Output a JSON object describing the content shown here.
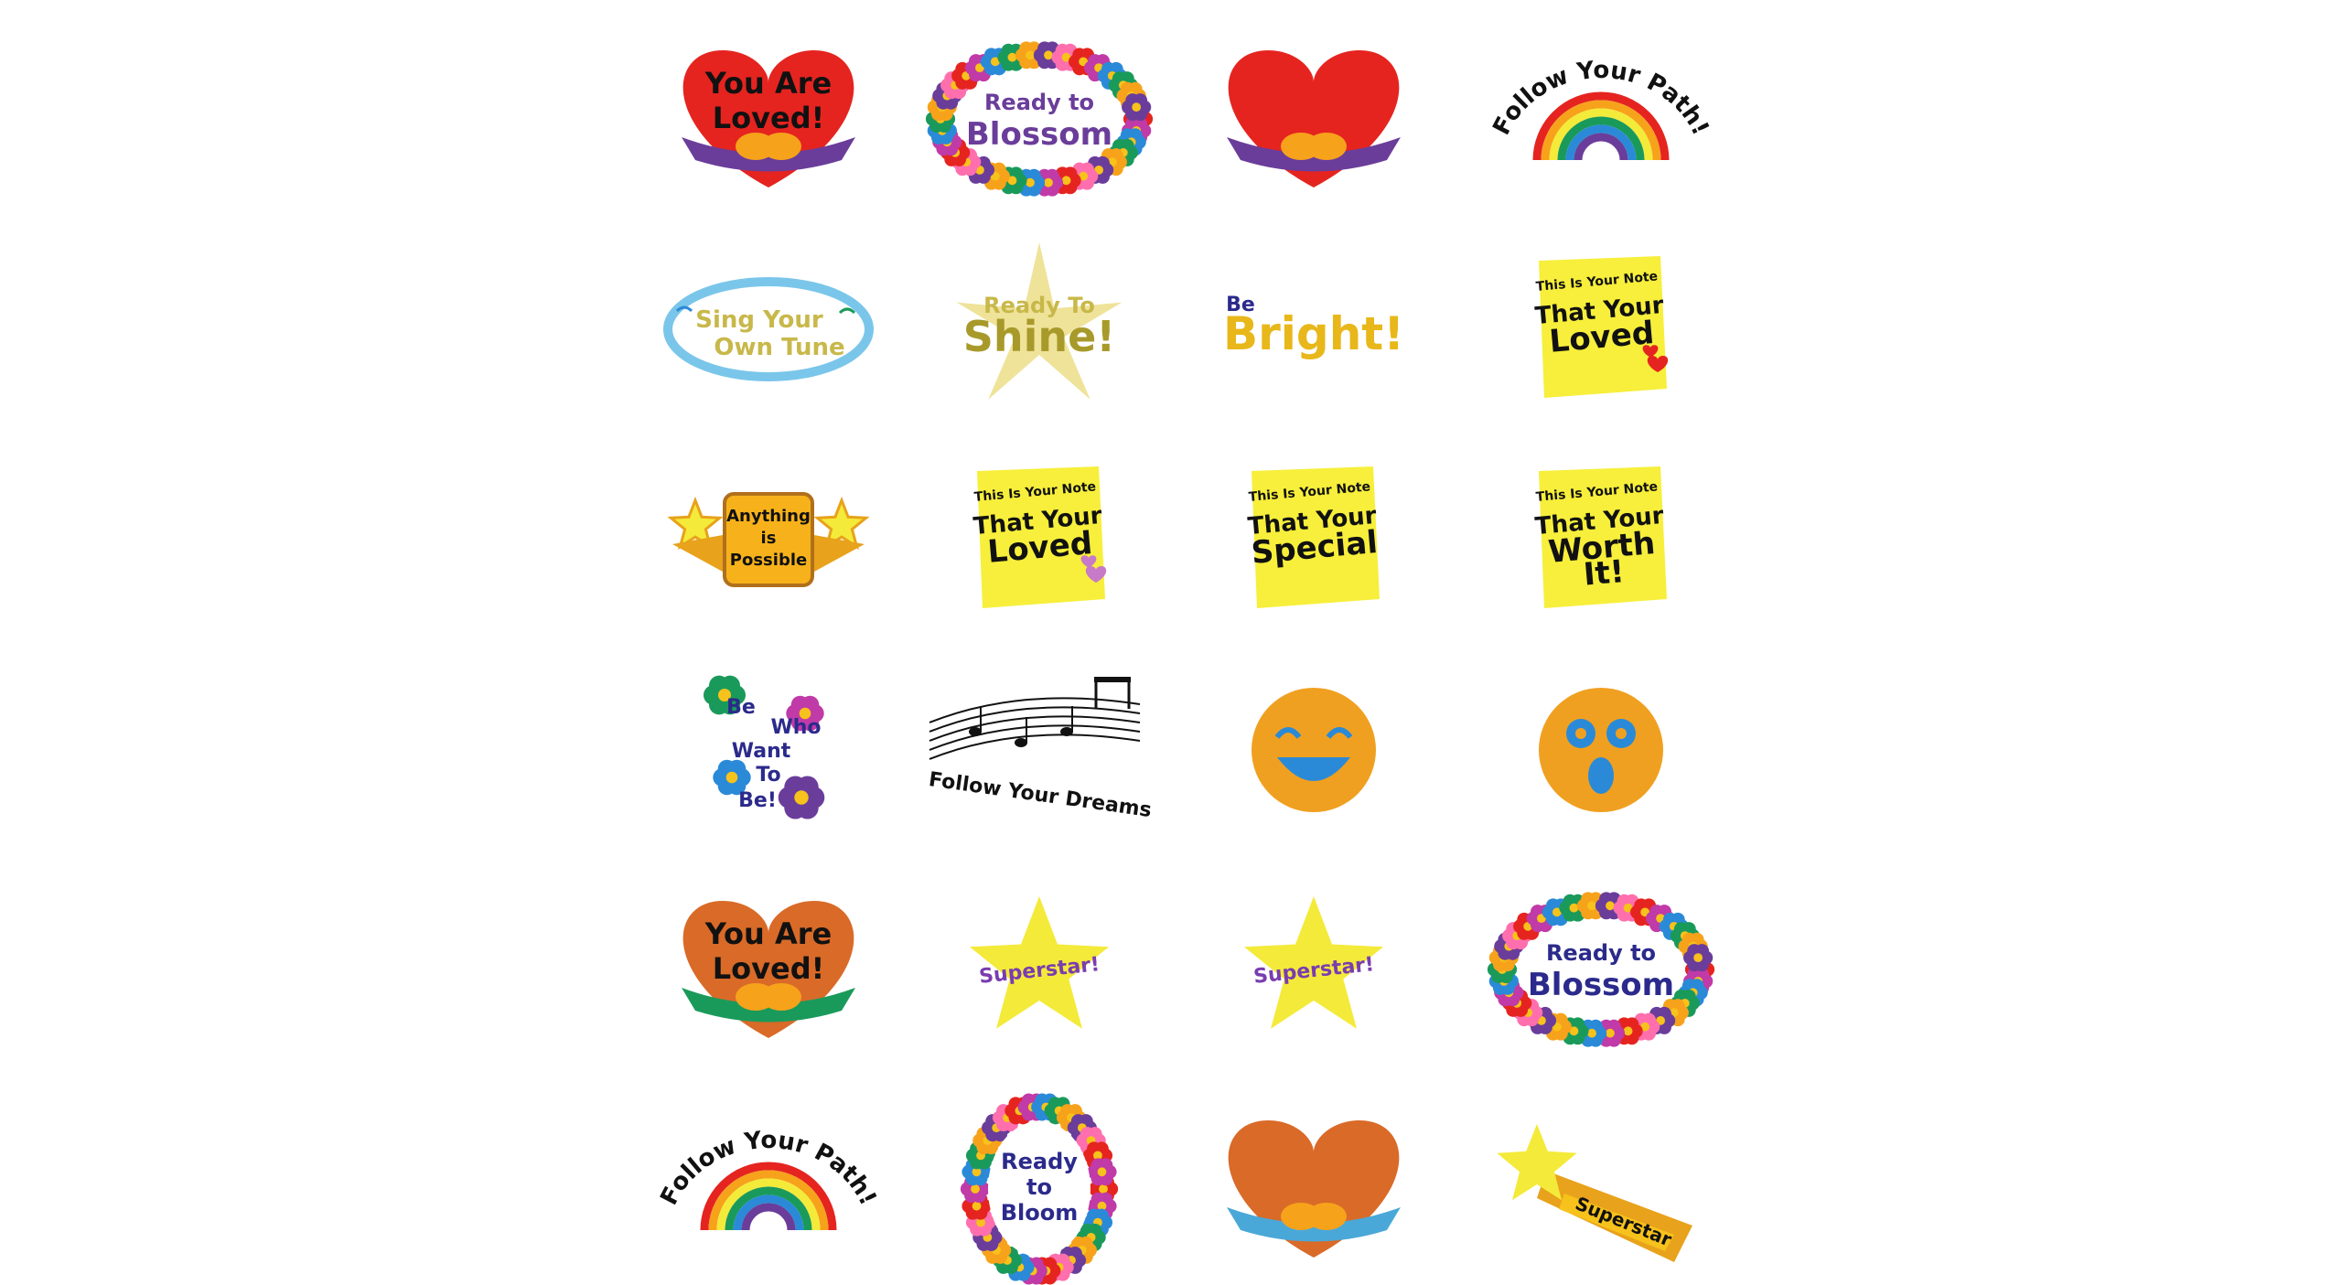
{
  "palette": {
    "red": "#e52420",
    "purple": "#6a3d9a",
    "orange_heart": "#d96a28",
    "orange_hands": "#f7a21b",
    "green_band": "#1a9a5a",
    "teal_band": "#4aa8d8",
    "yellow": "#f4ea3a",
    "note_yellow": "#f7ef3b",
    "gold": "#c8b84a",
    "navy": "#2b2a8c",
    "black": "#111111",
    "emoji_orange": "#f0a020",
    "emoji_blue": "#2a8ad8"
  },
  "stickers": [
    {
      "id": "s1",
      "kind": "heart",
      "heart": "#e52420",
      "band": "#6a3d9a",
      "lines": [
        "You Are",
        "Loved!"
      ]
    },
    {
      "id": "s2",
      "kind": "flower-oval",
      "lines": [
        "Ready to",
        "Blossom"
      ],
      "text_color": "#6a3d9a"
    },
    {
      "id": "s3",
      "kind": "heart",
      "heart": "#e52420",
      "band": "#6a3d9a",
      "lines": []
    },
    {
      "id": "s4",
      "kind": "rainbow-arc",
      "text": "Follow Your Path!"
    },
    {
      "id": "s5",
      "kind": "oval-birds",
      "lines": [
        "Sing Your",
        "Own Tune"
      ]
    },
    {
      "id": "s6",
      "kind": "sunburst",
      "lines": [
        "Ready To",
        "Shine!"
      ]
    },
    {
      "id": "s7",
      "kind": "be-bright",
      "small": "Be",
      "big": "Bright!"
    },
    {
      "id": "s8",
      "kind": "note",
      "lines": [
        "This Is Your Note",
        "That Your",
        "Loved"
      ],
      "hearts": "#e52420"
    },
    {
      "id": "s9",
      "kind": "star-badge",
      "lines": [
        "Anything",
        "is",
        "Possible"
      ]
    },
    {
      "id": "s10",
      "kind": "note",
      "lines": [
        "This Is Your Note",
        "That Your",
        "Loved"
      ],
      "hearts": "#c77ac7"
    },
    {
      "id": "s11",
      "kind": "note",
      "lines": [
        "This Is Your Note",
        "That Your",
        "Special"
      ],
      "hearts": ""
    },
    {
      "id": "s12",
      "kind": "note",
      "lines": [
        "This Is Your Note",
        "That Your",
        "Worth",
        "It!"
      ],
      "hearts": ""
    },
    {
      "id": "s13",
      "kind": "flowers-words",
      "lines": [
        "Be",
        "Who",
        "Want",
        "To",
        "Be!"
      ]
    },
    {
      "id": "s14",
      "kind": "music",
      "text": "Follow Your Dreams"
    },
    {
      "id": "s15",
      "kind": "emoji-laugh"
    },
    {
      "id": "s16",
      "kind": "emoji-surprise"
    },
    {
      "id": "s17",
      "kind": "heart",
      "heart": "#d96a28",
      "band": "#1a9a5a",
      "lines": [
        "You Are",
        "Loved!"
      ]
    },
    {
      "id": "s18",
      "kind": "star",
      "text": "Superstar!"
    },
    {
      "id": "s19",
      "kind": "star",
      "text": "Superstar!"
    },
    {
      "id": "s20",
      "kind": "flower-oval",
      "lines": [
        "Ready to",
        "Blossom"
      ],
      "text_color": "#2b2a8c"
    },
    {
      "id": "s21",
      "kind": "rainbow-arc",
      "text": "Follow Your Path!"
    },
    {
      "id": "s22",
      "kind": "flower-frame",
      "lines": [
        "Ready",
        "to",
        "Bloom"
      ]
    },
    {
      "id": "s23",
      "kind": "heart",
      "heart": "#d96a28",
      "band": "#4aa8d8",
      "lines": []
    },
    {
      "id": "s24",
      "kind": "shooting-star",
      "text": "Superstar"
    }
  ]
}
